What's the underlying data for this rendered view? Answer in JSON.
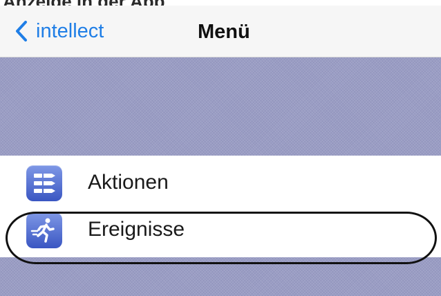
{
  "caption": {
    "text": "Anzeige in der App"
  },
  "navbar": {
    "back_label": "intellect",
    "title": "Menü"
  },
  "menu": {
    "items": [
      {
        "label": "Aktionen",
        "icon": "list-actions-icon"
      },
      {
        "label": "Ereignisse",
        "icon": "running-person-icon"
      }
    ]
  },
  "colors": {
    "accent": "#1f7ee6",
    "band": "#9a9dc4",
    "icon_gradient_top": "#7f98e6",
    "icon_gradient_bottom": "#3a56c2"
  }
}
